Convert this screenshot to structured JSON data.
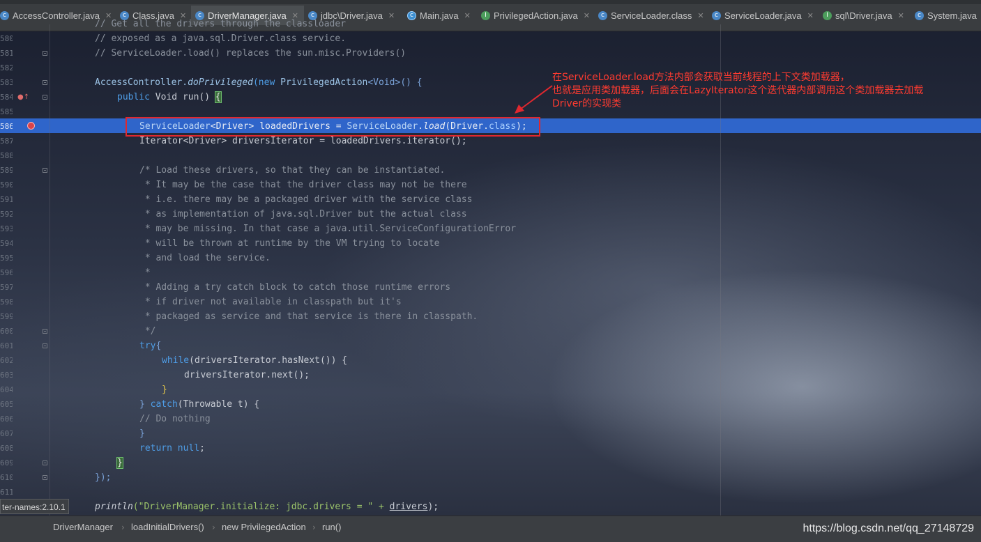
{
  "tabs": [
    {
      "label": "AccessController.java",
      "icon": "class-icon",
      "active": false
    },
    {
      "label": "Class.java",
      "icon": "class-icon",
      "active": false
    },
    {
      "label": "DriverManager.java",
      "icon": "class-icon",
      "active": true
    },
    {
      "label": "jdbc\\Driver.java",
      "icon": "class-icon",
      "active": false
    },
    {
      "label": "Main.java",
      "icon": "main-class-icon",
      "active": false
    },
    {
      "label": "PrivilegedAction.java",
      "icon": "interface-icon",
      "active": false
    },
    {
      "label": "ServiceLoader.class",
      "icon": "class-icon",
      "active": false
    },
    {
      "label": "ServiceLoader.java",
      "icon": "class-icon",
      "active": false
    },
    {
      "label": "sql\\Driver.java",
      "icon": "interface-icon",
      "active": false
    },
    {
      "label": "System.java",
      "icon": "class-icon",
      "active": false
    }
  ],
  "line_numbers": [
    "580",
    "581",
    "582",
    "583",
    "584",
    "585",
    "586",
    "587",
    "588",
    "589",
    "590",
    "591",
    "592",
    "593",
    "594",
    "595",
    "596",
    "597",
    "598",
    "599",
    "600",
    "601",
    "602",
    "603",
    "604",
    "605",
    "606",
    "607",
    "608",
    "609",
    "610",
    "611"
  ],
  "code": {
    "l579": "// Get all the drivers through the classloader",
    "l580": "// exposed as a java.sql.Driver.class service.",
    "l581": "// ServiceLoader.load() replaces the sun.misc.Providers()",
    "l583_a": "AccessController.",
    "l583_b": "doPrivileged",
    "l583_c": "(new ",
    "l583_d": "PrivilegedAction",
    "l583_e": "<Void>() {",
    "l584_a": "public ",
    "l584_b": "Void ",
    "l584_c": "run() ",
    "l584_d": "{",
    "l586_a": "ServiceLoader",
    "l586_b": "<Driver> loadedDrivers = ",
    "l586_c": "ServiceLoader",
    "l586_d": ".",
    "l586_e": "load",
    "l586_f": "(Driver.",
    "l586_g": "class",
    "l586_h": ");",
    "l587": "Iterator<Driver> driversIterator = loadedDrivers.iterator();",
    "l589": "/* Load these drivers, so that they can be instantiated.",
    "l590": " * It may be the case that the driver class may not be there",
    "l591": " * i.e. there may be a packaged driver with the service class",
    "l592": " * as implementation of java.sql.Driver but the actual class",
    "l593": " * may be missing. In that case a java.util.ServiceConfigurationError",
    "l594": " * will be thrown at runtime by the VM trying to locate",
    "l595": " * and load the service.",
    "l596": " *",
    "l597": " * Adding a try catch block to catch those runtime errors",
    "l598": " * if driver not available in classpath but it's",
    "l599": " * packaged as service and that service is there in classpath.",
    "l600": " */",
    "l601_a": "try",
    "l601_b": "{",
    "l602_a": "while",
    "l602_b": "(driversIterator.hasNext()) {",
    "l603": "driversIterator.next();",
    "l604": "}",
    "l605_a": "} ",
    "l605_b": "catch",
    "l605_c": "(Throwable t) {",
    "l606": "// Do nothing",
    "l607": "}",
    "l608_a": "return ",
    "l608_b": "null",
    "l608_c": ";",
    "l609": "}",
    "l610": "});",
    "l612_a": "println",
    "l612_b": "(\"DriverManager.initialize: jdbc.drivers = \" + ",
    "l612_c": "drivers",
    "l612_d": ");"
  },
  "annotation": {
    "line1": "在ServiceLoader.load方法内部会获取当前线程的上下文类加载器，",
    "line2": "也就是应用类加载器，后面会在LazyIterator这个迭代器内部调用这个类加载器去加载",
    "line3": "Driver的实现类",
    "color": "#ff3b30"
  },
  "tooltip": "ter-names:2.10.1",
  "breadcrumb": [
    "DriverManager",
    "loadInitialDrivers()",
    "new PrivilegedAction",
    "run()"
  ],
  "watermark": "https://blog.csdn.net/qq_27148729",
  "colors": {
    "highlight_line": "#2f65ca",
    "keyword": "#4e9de6",
    "string": "#9bc36a",
    "comment": "#8a919c",
    "annotation_red": "#e0282f"
  }
}
